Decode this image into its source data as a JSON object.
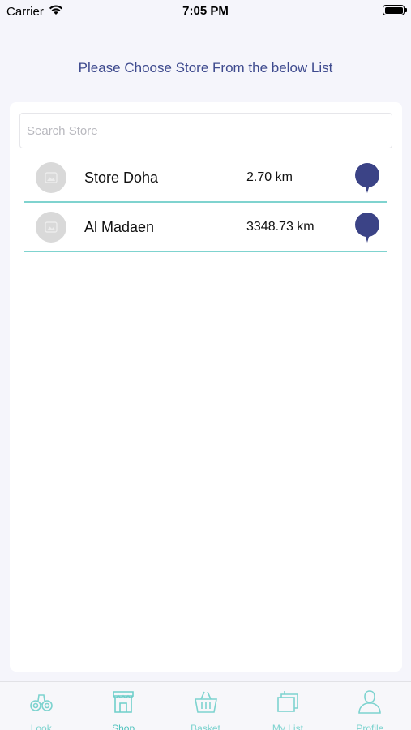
{
  "status_bar": {
    "carrier": "Carrier",
    "time": "7:05 PM"
  },
  "page": {
    "heading": "Please Choose Store From the below List"
  },
  "search": {
    "placeholder": "Search Store",
    "value": ""
  },
  "stores": [
    {
      "name": "Store Doha",
      "distance": "2.70 km"
    },
    {
      "name": "Al Madaen",
      "distance": "3348.73 km"
    }
  ],
  "colors": {
    "accent": "#7fd3cf",
    "heading": "#3e4a8e",
    "pin": "#3b4386"
  },
  "tabs": [
    {
      "label": "Look",
      "icon": "binoculars-icon",
      "active": false
    },
    {
      "label": "Shop",
      "icon": "storefront-icon",
      "active": true
    },
    {
      "label": "Basket",
      "icon": "basket-icon",
      "active": false
    },
    {
      "label": "My List",
      "icon": "stacked-list-icon",
      "active": false
    },
    {
      "label": "Profile",
      "icon": "person-icon",
      "active": false
    }
  ]
}
